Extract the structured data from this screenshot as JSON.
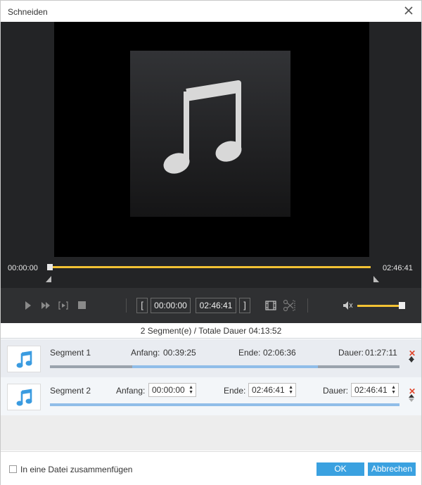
{
  "window": {
    "title": "Schneiden"
  },
  "player": {
    "current_time": "00:00:00",
    "total_time": "02:46:41",
    "progress": 0.0,
    "start_field": "00:00:00",
    "end_field": "02:46:41",
    "volume": 0.9
  },
  "summary": "2 Segment(e) / Totale Dauer 04:13:52",
  "segments": [
    {
      "name": "Segment 1",
      "start_label": "Anfang:",
      "start": "00:39:25",
      "end_label": "Ende:",
      "end": "02:06:36",
      "duration_label": "Dauer:",
      "duration": "01:27:11",
      "selection_start": 0.235,
      "selection_end": 0.767
    },
    {
      "name": "Segment 2",
      "start_label": "Anfang:",
      "start": "00:00:00",
      "end_label": "Ende:",
      "end": "02:46:41",
      "duration_label": "Dauer:",
      "duration": "02:46:41",
      "selection_start": 0.0,
      "selection_end": 1.0
    }
  ],
  "footer": {
    "merge_label": "In eine Datei zusammenfügen",
    "merge_checked": false,
    "ok_label": "OK",
    "cancel_label": "Abbrechen"
  },
  "colors": {
    "accent": "#f3c234",
    "button": "#3aa1e0",
    "delete": "#e0452b",
    "selection": "#90bde8"
  }
}
